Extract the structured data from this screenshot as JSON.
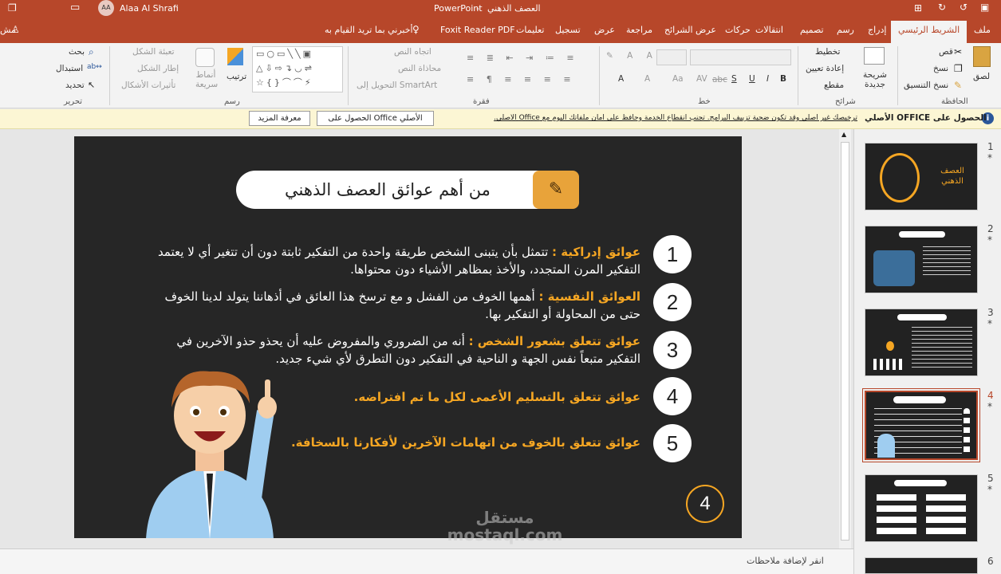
{
  "titlebar": {
    "doc_title": "العصف الذهني",
    "app_name": "PowerPoint",
    "separator": "-",
    "user_name": "Alaa Al Shrafi",
    "user_initials": "AA"
  },
  "tabs": {
    "file": "ملف",
    "home": "الشريط الرئيسي",
    "insert": "إدراج",
    "draw": "رسم",
    "design": "تصميم",
    "transitions": "انتقالات",
    "animations": "حركات",
    "slideshow": "عرض الشرائح",
    "review": "مراجعة",
    "view": "عرض",
    "record": "تسجيل",
    "help": "تعليمات",
    "foxit": "Foxit Reader PDF",
    "tell_me": "أخبرني بما تريد القيام به",
    "share": "مش"
  },
  "ribbon": {
    "clipboard": {
      "paste": "لصق",
      "cut": "قص",
      "copy": "نسخ",
      "format_painter": "نسخ التنسيق",
      "group": "الحافظة"
    },
    "slides": {
      "new_slide": "شريحة جديدة",
      "layout": "تخطيط",
      "reset": "إعادة تعيين",
      "section": "مقطع",
      "group": "شرائح"
    },
    "font": {
      "group": "خط",
      "bold": "B",
      "italic": "I",
      "underline": "U",
      "strike": "S",
      "abc": "abc",
      "av": "AV",
      "aa": "Aa",
      "a": "A"
    },
    "paragraph": {
      "text_direction": "اتجاه النص",
      "align_text": "محاذاة النص",
      "smartart": "التحويل إلى SmartArt",
      "group": "فقرة"
    },
    "drawing": {
      "arrange": "ترتيب",
      "quick_styles": "أنماط سريعة",
      "shape_fill": "تعبئة الشكل",
      "shape_outline": "إطار الشكل",
      "shape_effects": "تأثيرات الأشكال",
      "group": "رسم"
    },
    "editing": {
      "find": "بحث",
      "replace": "استبدال",
      "select": "تحديد",
      "group": "تحرير"
    }
  },
  "infobar": {
    "title": "الحصول على OFFICE الأصلي",
    "message": "ترخيصك غير أصلي وقد تكون ضحية تزييف البرامج. تجنب انقطاع الخدمة وحافظ على أمان ملفاتك اليوم مع Office الأصلي.",
    "get_button": "الحصول على Office الأصلي",
    "learn_button": "معرفة المزيد"
  },
  "slide": {
    "title": "من أهم عوائق العصف الذهني",
    "items": [
      {
        "num": "1",
        "head": "عوائق إدراكية :",
        "body": " تتمثل بأن يتبنى الشخص طريقة واحدة من التفكير ثابتة دون أن تتغير أي لا يعتمد التفكير المرن المتجدد، والأخذ بمظاهر الأشياء دون محتواها."
      },
      {
        "num": "2",
        "head": "العوائق النفسية :",
        "body": " أهمها الخوف من الفشل و مع ترسخ هذا العائق في أذهاننا يتولد لدينا الخوف حتى من المحاولة أو التفكير بها."
      },
      {
        "num": "3",
        "head": "عوائق تتعلق بشعور الشخص :",
        "body": " أنه من الضروري والمفروض عليه أن يحذو حذو الآخرين في التفكير متبعاً نفس الجهة و الناحية في التفكير دون التطرق لأي شيء جديد."
      },
      {
        "num": "4",
        "head": "عوائق تتعلق بالتسليم الأعمى لكل ما تم افتراضه.",
        "body": ""
      },
      {
        "num": "5",
        "head": "عوائق تتعلق بالخوف من اتهامات الآخرين لأفكارنا بالسخافة.",
        "body": ""
      }
    ],
    "page_number": "4",
    "watermark": "مستقل mostaql.com"
  },
  "thumbnails": [
    {
      "num": "1",
      "star": "*",
      "text": "العصف الذهني"
    },
    {
      "num": "2",
      "star": "*",
      "text": ""
    },
    {
      "num": "3",
      "star": "*",
      "text": ""
    },
    {
      "num": "4",
      "star": "*",
      "text": ""
    },
    {
      "num": "5",
      "star": "*",
      "text": ""
    },
    {
      "num": "6",
      "star": "",
      "text": ""
    }
  ],
  "notes": {
    "placeholder": "انقر لإضافة ملاحظات"
  },
  "colors": {
    "accent": "#b7472a",
    "slide_bg": "#262626",
    "highlight": "#f5a623",
    "info_bg": "#fcf6d4"
  }
}
